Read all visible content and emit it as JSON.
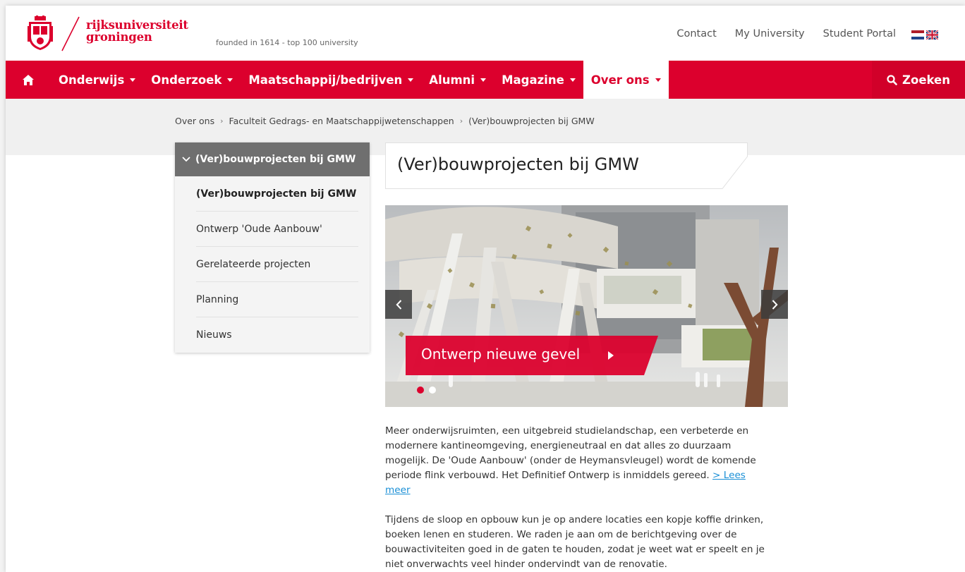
{
  "header": {
    "logo_line1": "rijksuniversiteit",
    "logo_line2": "groningen",
    "tagline": "founded in 1614  -  top 100 university",
    "links": [
      "Contact",
      "My University",
      "Student Portal"
    ],
    "brand_color": "#dc002d"
  },
  "nav": {
    "home_icon": "home-icon",
    "items": [
      {
        "label": "Onderwijs"
      },
      {
        "label": "Onderzoek"
      },
      {
        "label": "Maatschappij/bedrijven"
      },
      {
        "label": "Alumni"
      },
      {
        "label": "Magazine"
      },
      {
        "label": "Over ons"
      }
    ],
    "active": "Over ons",
    "search_label": "Zoeken"
  },
  "breadcrumb": [
    "Over ons",
    "Faculteit Gedrags- en Maatschappijwetenschappen",
    "(Ver)bouwprojecten bij GMW"
  ],
  "sidebar": {
    "heading": "(Ver)bouwprojecten bij GMW",
    "items": [
      {
        "label": "(Ver)bouwprojecten bij GMW"
      },
      {
        "label": "Ontwerp 'Oude Aanbouw'"
      },
      {
        "label": "Gerelateerde projecten"
      },
      {
        "label": "Planning"
      },
      {
        "label": "Nieuws"
      }
    ]
  },
  "main": {
    "title": "(Ver)bouwprojecten bij GMW",
    "carousel": {
      "caption": "Ontwerp nieuwe gevel",
      "slide_count": 2,
      "active_slide": 1
    },
    "paragraph1": "Meer onderwijsruimten, een uitgebreid studielandschap, een verbeterde en modernere kantineomgeving, energieneutraal en dat alles zo duurzaam mogelijk. De 'Oude Aanbouw' (onder de Heymansvleugel) wordt de komende periode flink verbouwd. Het Definitief Ontwerp is inmiddels gereed.",
    "read_more": "> Lees meer",
    "paragraph2": "Tijdens de sloop en opbouw kun je op andere locaties een kopje koffie drinken, boeken lenen en studeren. We raden je aan om de berichtgeving over de bouwactiviteiten goed in de gaten te houden, zodat je weet wat er speelt en je niet onverwachts veel hinder ondervindt van de renovatie."
  }
}
